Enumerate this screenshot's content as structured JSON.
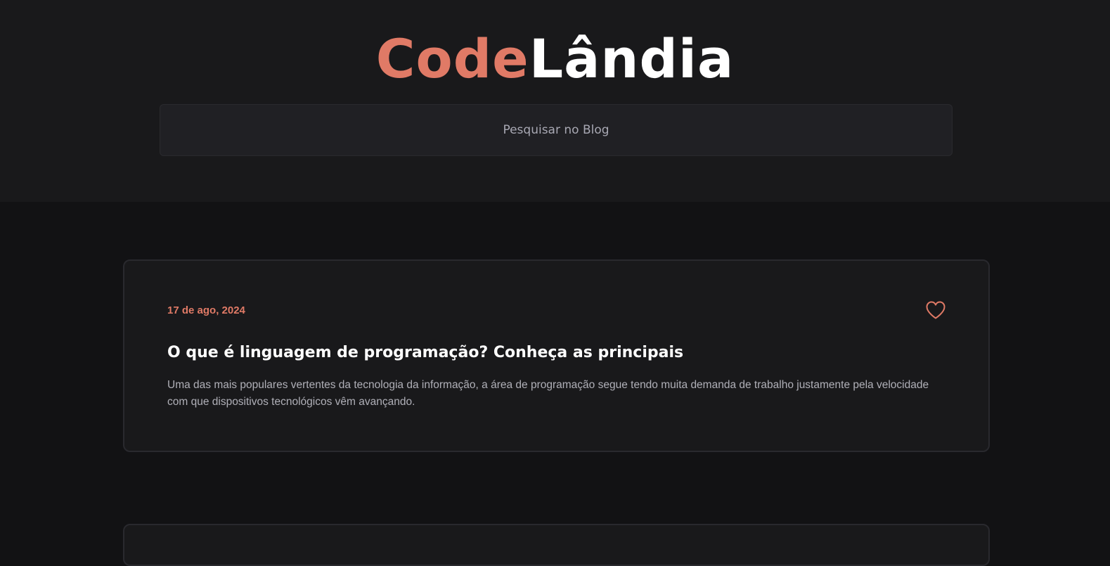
{
  "header": {
    "logo_part1": "Code",
    "logo_part2": "Lândia"
  },
  "search": {
    "placeholder": "Pesquisar no Blog"
  },
  "posts": [
    {
      "date": "17 de ago, 2024",
      "title": "O que é linguagem de programação? Conheça as principais",
      "excerpt": "Uma das mais populares vertentes da tecnologia da informação, a área de programação segue tendo muita demanda de trabalho justamente pela velocidade com que dispositivos tecnológicos vêm avançando.",
      "favorite_icon": "heart-icon"
    }
  ],
  "colors": {
    "accent": "#e07a66",
    "background": "#121214",
    "header_background": "#19191b",
    "card_background": "#19191b",
    "text_primary": "#ffffff",
    "text_secondary": "#b0b0b8"
  }
}
